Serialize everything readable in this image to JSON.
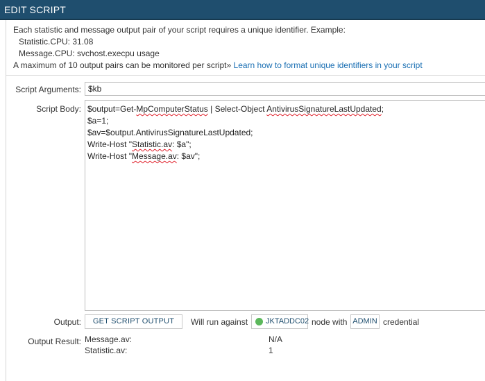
{
  "header": {
    "title": "EDIT SCRIPT"
  },
  "info": {
    "line1": "Each statistic and message output pair of your script requires a unique identifier. Example:",
    "example_statistic": "Statistic.CPU: 31.08",
    "example_message": "Message.CPU: svchost.execpu usage",
    "max_text": "A maximum of 10 output pairs can be monitored per script",
    "max_arrow": "»",
    "link_text": "Learn how to format unique identifiers in your script"
  },
  "arguments": {
    "label": "Script Arguments:",
    "value": "$kb"
  },
  "body": {
    "label": "Script Body:",
    "lines": [
      [
        {
          "t": "$output=Get-"
        },
        {
          "t": "MpComputerStatus",
          "spell": true
        },
        {
          "t": " | Select-Object "
        },
        {
          "t": "AntivirusSignatureLastUpdated",
          "spell": true
        },
        {
          "t": ";"
        }
      ],
      [
        {
          "t": "$a=1;"
        }
      ],
      [
        {
          "t": "$av=$output.AntivirusSignatureLastUpdated;"
        }
      ],
      [
        {
          "t": "Write-Host \""
        },
        {
          "t": "Statistic.av",
          "spell": true
        },
        {
          "t": ": $a\";"
        }
      ],
      [
        {
          "t": "Write-Host \""
        },
        {
          "t": "Message.av",
          "spell": true
        },
        {
          "t": ": $av\";"
        }
      ]
    ]
  },
  "output": {
    "label": "Output:",
    "button_label": "GET SCRIPT OUTPUT",
    "will_run_text": "Will run against",
    "node_name": "JKTADDC02",
    "node_with_text": "node with",
    "credential_name": "ADMIN",
    "credential_text": "credential",
    "status_color": "#5cb85c"
  },
  "result": {
    "label": "Output Result:",
    "rows": [
      {
        "name": "Message.av:",
        "value": "N/A"
      },
      {
        "name": "Statistic.av:",
        "value": "1"
      }
    ]
  }
}
